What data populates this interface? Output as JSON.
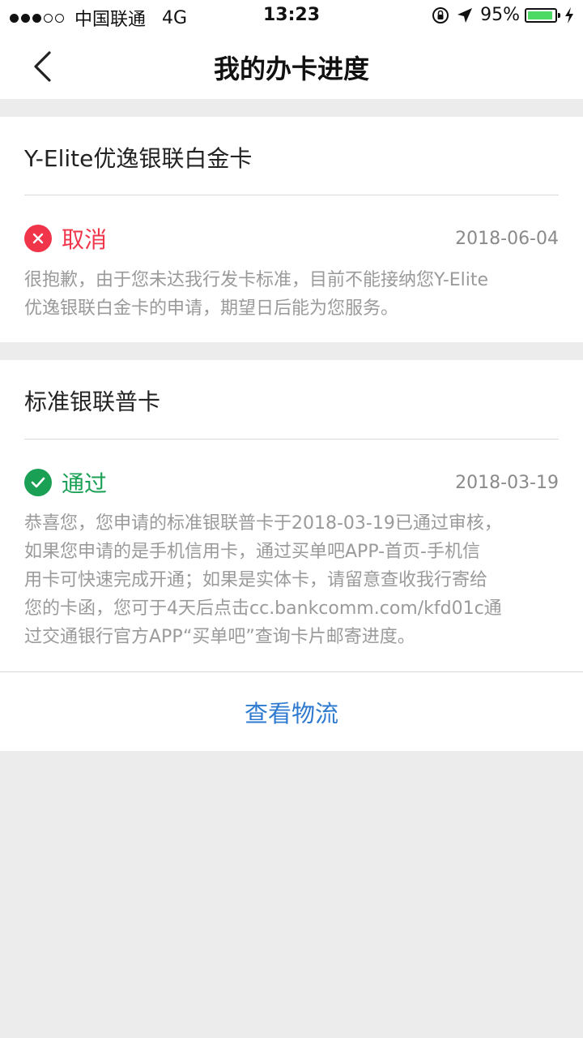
{
  "status_bar": {
    "carrier": "中国联通",
    "network": "4G",
    "time": "13:23",
    "battery": "95%",
    "battery_level": 0.95
  },
  "nav": {
    "title": "我的办卡进度",
    "back_icon": "chevron-left-icon"
  },
  "applications": [
    {
      "card_name": "Y-Elite优逸银联白金卡",
      "status": "取消",
      "status_color": "#f0344a",
      "status_icon": "close-circle-icon",
      "date": "2018-06-04",
      "description_lines": [
        "很抱歉，由于您未达我行发卡标准，目前不能接纳您Y-Elite",
        "优逸银联白金卡的申请，期望日后能为您服务。"
      ]
    },
    {
      "card_name": "标准银联普卡",
      "status": "通过",
      "status_color": "#1aa055",
      "status_icon": "check-circle-icon",
      "date": "2018-03-19",
      "description_lines": [
        "恭喜您，您申请的标准银联普卡于2018-03-19已通过审核，",
        "如果您申请的是手机信用卡，通过买单吧APP-首页-手机信",
        "用卡可快速完成开通；如果是实体卡，请留意查收我行寄给",
        "您的卡函，您可于4天后点击cc.bankcomm.com/kfd01c通",
        "过交通银行官方APP“买单吧”查询卡片邮寄进度。"
      ],
      "action_label": "查看物流",
      "action_color": "#2e7ad0"
    }
  ]
}
